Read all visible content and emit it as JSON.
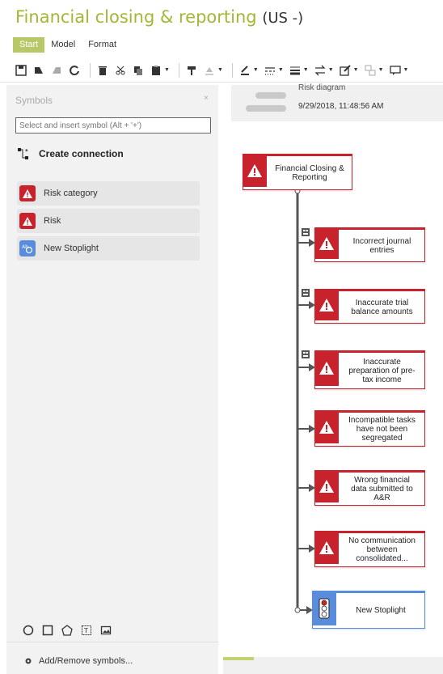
{
  "app": {
    "title": "Financial closing & reporting",
    "language": "(US -)"
  },
  "tabs": [
    {
      "label": "Start",
      "active": true
    },
    {
      "label": "Model",
      "active": false
    },
    {
      "label": "Format",
      "active": false
    }
  ],
  "symbols_panel": {
    "title": "Symbols",
    "close_glyph": "×",
    "search_placeholder": "Select and insert symbol (Alt + '+')",
    "create_connection": "Create connection",
    "items": [
      {
        "label": "Risk category",
        "icon": "warning-icon",
        "color": "#c8232c"
      },
      {
        "label": "Risk",
        "icon": "warning-icon",
        "color": "#c8232c"
      },
      {
        "label": "New Stoplight",
        "icon": "stoplight-icon",
        "color": "#5a8cdc"
      }
    ],
    "add_remove": "Add/Remove symbols..."
  },
  "canvas": {
    "header_title": "Risk diagram",
    "header_timestamp": "9/29/2018, 11:48:56 AM",
    "root": {
      "label_line1": "Financial Closing &",
      "label_line2": "Reporting"
    },
    "risks": [
      {
        "label": "Incorrect journal entries",
        "line1": "Incorrect journal",
        "line2": "entries",
        "line3": "",
        "line4": ""
      },
      {
        "label": "Inaccurate trial balance amounts",
        "line1": "Inaccurate trial",
        "line2": "balance amounts",
        "line3": "",
        "line4": ""
      },
      {
        "label": "Inaccurate preparation of pre-tax income",
        "line1": "Inaccurate",
        "line2": "preparation of pre-",
        "line3": "tax income",
        "line4": ""
      },
      {
        "label": "Incompatible tasks have not been segregated",
        "line1": "Incompatible tasks",
        "line2": "have not been",
        "line3": "segregated",
        "line4": ""
      },
      {
        "label": "Wrong financial data submitted to A&R",
        "line1": "Wrong financial",
        "line2": "data submitted to",
        "line3": "A&R",
        "line4": ""
      },
      {
        "label": "No communication between consolidated...",
        "line1": "No communication",
        "line2": "between",
        "line3": "consolidated...",
        "line4": ""
      }
    ],
    "stoplight": {
      "label": "New Stoplight"
    }
  },
  "colors": {
    "accent": "#a4b636",
    "risk": "#c8232c",
    "stoplight": "#5a8cdc"
  }
}
